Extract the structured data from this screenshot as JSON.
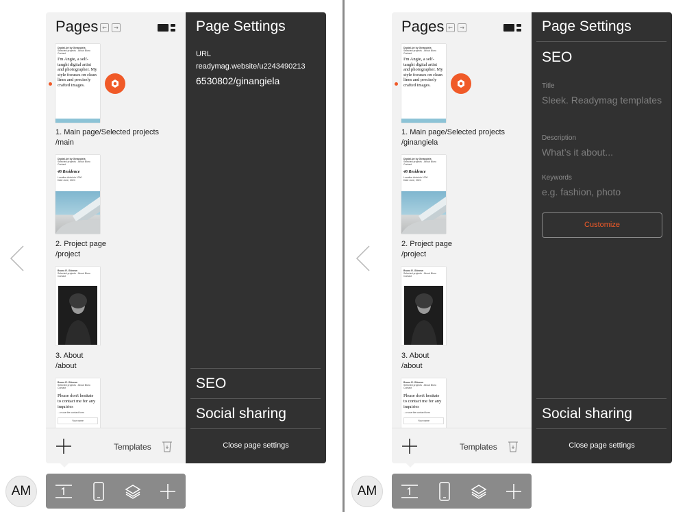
{
  "colors": {
    "accent": "#f05a28",
    "panel_dark": "#313131",
    "panel_light": "#f2f2f2",
    "toolbar": "#8a8a8a"
  },
  "screens": [
    {
      "pages_title": "Pages",
      "pages": [
        {
          "name": "1. Main page/Selected projects",
          "slug": "/main",
          "active": true
        },
        {
          "name": "2. Project page",
          "slug": "/project"
        },
        {
          "name": "3. About",
          "slug": "/about"
        }
      ],
      "footer": {
        "templates_label": "Templates"
      },
      "settings": {
        "title": "Page Settings",
        "url_label": "URL",
        "url_line1": "readymag.website/u2243490213",
        "url_line2": "6530802/ginangiela",
        "sections": [
          "SEO",
          "Social sharing"
        ],
        "close_label": "Close page settings"
      },
      "avatar_initials": "AM"
    },
    {
      "pages_title": "Pages",
      "pages": [
        {
          "name": "1. Main page/Selected projects",
          "slug": "/ginangiela",
          "active": true
        },
        {
          "name": "2. Project page",
          "slug": "/project"
        },
        {
          "name": "3. About",
          "slug": "/about"
        }
      ],
      "footer": {
        "templates_label": "Templates"
      },
      "settings": {
        "title": "Page Settings",
        "seo_title": "SEO",
        "fields": [
          {
            "label": "Title",
            "value": "Sleek. Readymag templates"
          },
          {
            "label": "Description",
            "value": "What’s it about..."
          },
          {
            "label": "Keywords",
            "value": "e.g. fashion, photo"
          }
        ],
        "customize_label": "Customize",
        "social_label": "Social sharing",
        "close_label": "Close page settings"
      },
      "avatar_initials": "AM"
    }
  ],
  "thumbnails": {
    "brand": "Digital Art by Ginangiela",
    "nav": [
      "Selected projects",
      "About Bioro",
      "Contact"
    ],
    "main_text": "I'm Angie, a self-taught digital artist and photographer. My style focuses on clean lines and precisely crafted images.",
    "project_title": "46 Residence",
    "project_meta1": "Location Antoinia 1000",
    "project_meta2": "Date June, 2024",
    "about_brand": "Bruno R. Gibrean",
    "contact_text": "Please don't hesitate to contact me for any inquiries",
    "contact_link": "...or use the contact form",
    "contact_field": "Your name"
  },
  "icons": [
    "chevron-left-icon",
    "arrow-left-icon",
    "arrow-right-icon",
    "view-toggle-icon",
    "gear-icon",
    "plus-icon",
    "trash-icon",
    "text-tool-icon",
    "mobile-icon",
    "layers-icon"
  ]
}
